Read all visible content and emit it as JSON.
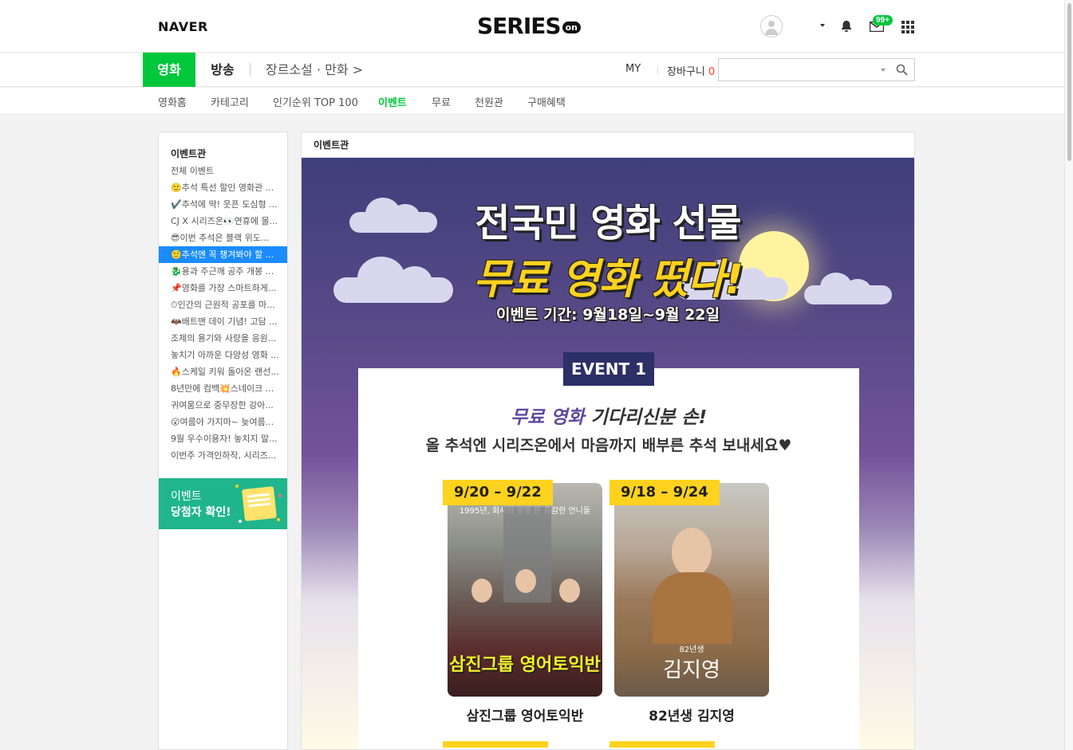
{
  "header": {
    "naver_logo": "NAVER",
    "series_logo": "SERIES",
    "series_logo_suffix": "on",
    "notification_badge": "99+"
  },
  "gnb": {
    "tabs": [
      {
        "label": "영화",
        "active": true
      },
      {
        "label": "방송",
        "active": false
      }
    ],
    "genre_link": "장르소설 · 만화 >",
    "my_label": "MY",
    "cart_label": "장바구니",
    "cart_count": "0",
    "search": {
      "value": "",
      "placeholder": ""
    }
  },
  "lnb": {
    "items": [
      {
        "label": "영화홈",
        "active": false
      },
      {
        "label": "카테고리",
        "active": false
      },
      {
        "label": "인기순위 TOP 100",
        "active": false
      },
      {
        "label": "이벤트",
        "active": true
      },
      {
        "label": "무료",
        "active": false
      },
      {
        "label": "천원관",
        "active": false
      },
      {
        "label": "구매혜택",
        "active": false
      }
    ]
  },
  "sidebar": {
    "title": "이벤트관",
    "items": [
      {
        "label": "전체 이벤트",
        "active": false
      },
      {
        "label": "🙂추석 특선 할인 영화관 ...",
        "active": false
      },
      {
        "label": "✔️추석에 딱! 웃픈 도심형 ...",
        "active": false
      },
      {
        "label": "CJ X 시리즈온👀연휴에 몰...",
        "active": false
      },
      {
        "label": "😎이번 추석은 블랙 위도...",
        "active": false
      },
      {
        "label": "🙂추석엔 꼭 챙겨봐야 할 ...",
        "active": true
      },
      {
        "label": "🐉용과 주근깨 공주 개봉 ...",
        "active": false
      },
      {
        "label": "📌영화를 가장 스마트하게...",
        "active": false
      },
      {
        "label": "⏱인간의 근원적 공포를 마...",
        "active": false
      },
      {
        "label": "🦇배트맨 데이 기념! 고담 ...",
        "active": false
      },
      {
        "label": "조제의 용기와 사랑을 응원...",
        "active": false
      },
      {
        "label": "놓치기 아까운 다양성 영화 ...",
        "active": false
      },
      {
        "label": "🔥스케일 키워 돌아온 랜선...",
        "active": false
      },
      {
        "label": "8년만에 컴백💥스네이크 ...",
        "active": false
      },
      {
        "label": "귀여움으로 중무장한 강아...",
        "active": false
      },
      {
        "label": "😮여름아 가지마~ 늦여름...",
        "active": false
      },
      {
        "label": "9월 우수이용자! 놓치지 말...",
        "active": false
      },
      {
        "label": "이번주 가격인하작, 시리즈...",
        "active": false
      }
    ],
    "winner_banner": {
      "line1": "이벤트",
      "line2": "당첨자 확인!"
    }
  },
  "main": {
    "title": "이벤트관",
    "banner": {
      "headline1": "전국민 영화 선물",
      "headline2": "무료 영화 떴다!",
      "period": "이벤트 기간: 9월18일~9월 22일",
      "event_tag": "EVENT 1",
      "card_line1_highlight": "무료 영화",
      "card_line1_rest": " 기다리신분 손!",
      "card_line2": "올 추석엔 시리즈온에서 마음까지 배부른 추석 보내세요♥",
      "posters": [
        {
          "date": "9/20 – 9/22",
          "top_text": "1995년, 회사와 맞짱 뜬 용감한 언니들",
          "poster_title": "삼진그룹 영어토익반",
          "caption": "삼진그룹 영어토익반"
        },
        {
          "date": "9/18 – 9/24",
          "poster_sub": "82년생",
          "poster_title": "김지영",
          "caption": "82년생 김지영"
        }
      ]
    }
  },
  "colors": {
    "brand_green": "#00c73c",
    "active_blue": "#1a8cff",
    "event_yellow": "#ffd21f",
    "event_navy": "#2b3066"
  }
}
